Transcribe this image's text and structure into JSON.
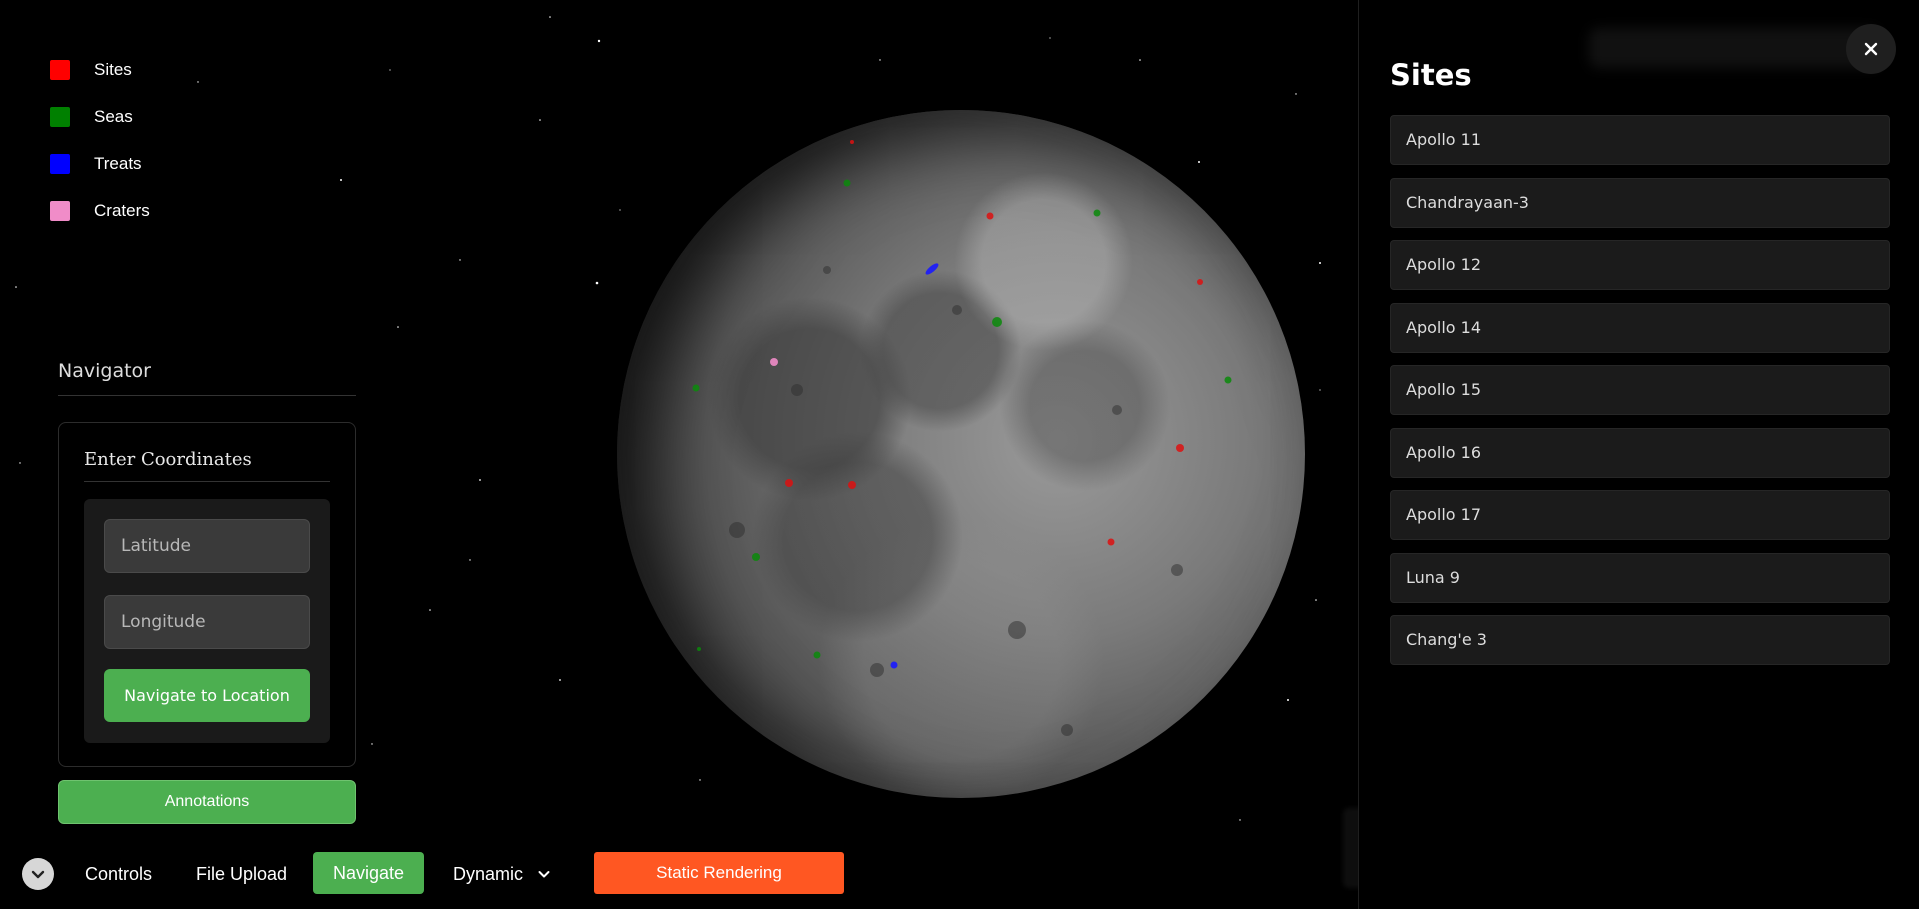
{
  "legend": {
    "items": [
      {
        "label": "Sites",
        "color": "#ff0000"
      },
      {
        "label": "Seas",
        "color": "#008000"
      },
      {
        "label": "Treats",
        "color": "#0000ff"
      },
      {
        "label": "Craters",
        "color": "#f08cc8"
      }
    ]
  },
  "navigator": {
    "title": "Navigator",
    "coordinates_title": "Enter Coordinates",
    "latitude_placeholder": "Latitude",
    "longitude_placeholder": "Longitude",
    "navigate_button": "Navigate to Location",
    "annotations_button": "Annotations"
  },
  "toolbar": {
    "controls": "Controls",
    "file_upload": "File Upload",
    "navigate": "Navigate",
    "dynamic": "Dynamic",
    "static_rendering": "Static Rendering"
  },
  "sidebar": {
    "title": "Sites",
    "close_icon": "close-icon",
    "sites": [
      "Apollo 11",
      "Chandrayaan-3",
      "Apollo 12",
      "Apollo 14",
      "Apollo 15",
      "Apollo 16",
      "Apollo 17",
      "Luna 9",
      "Chang'e 3"
    ]
  },
  "colors": {
    "accent_green": "#4caf50",
    "accent_orange": "#ff5722"
  }
}
